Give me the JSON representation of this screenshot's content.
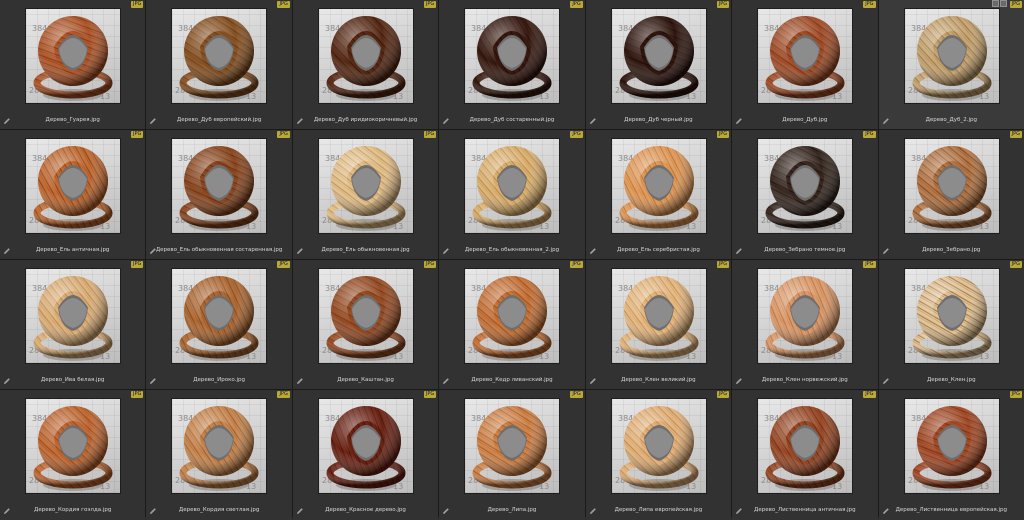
{
  "badge_label": "JPG",
  "materials": [
    {
      "name": "Дерево_Гуарея.jpg",
      "wood": "#b0582a",
      "grain": "#7a3112"
    },
    {
      "name": "Дерево_Дуб европейский.jpg",
      "wood": "#8a5424",
      "grain": "#5c3210"
    },
    {
      "name": "Дерево_Дуб иридиокоричневый.jpg",
      "wood": "#5a2a14",
      "grain": "#2e1208"
    },
    {
      "name": "Дерево_Дуб состаренный.jpg",
      "wood": "#3a1a10",
      "grain": "#1a0a06"
    },
    {
      "name": "Дерево_Дуб черный.jpg",
      "wood": "#32170f",
      "grain": "#150806"
    },
    {
      "name": "Дерево_Дуб.jpg",
      "wood": "#a4502a",
      "grain": "#6e2c12"
    },
    {
      "name": "Дерево_Дуб_2.jpg",
      "wood": "#c7a572",
      "grain": "#8a6a3c",
      "selected": true
    },
    {
      "name": "Дерево_Ель античная.jpg",
      "wood": "#c26a30",
      "grain": "#7e3812"
    },
    {
      "name": "Дерево_Ель обыкновенная состаренная.jpg",
      "wood": "#8e4a22",
      "grain": "#5a2a10"
    },
    {
      "name": "Дерево_Ель обыкновенная.jpg",
      "wood": "#e3c08a",
      "grain": "#b08850"
    },
    {
      "name": "Дерево_Ель обыкновенная_2.jpg",
      "wood": "#dcb272",
      "grain": "#a87c3e"
    },
    {
      "name": "Дерево_Ель серебристая.jpg",
      "wood": "#e09a5a",
      "grain": "#b26a2c"
    },
    {
      "name": "Дерево_Зебрано темное.jpg",
      "wood": "#3a2a22",
      "grain": "#140c08"
    },
    {
      "name": "Дерево_Зебрано.jpg",
      "wood": "#b67644",
      "grain": "#6a3a18"
    },
    {
      "name": "Дерево_Ива белая.jpg",
      "wood": "#ddb07a",
      "grain": "#a8804a"
    },
    {
      "name": "Дерево_Ироко.jpg",
      "wood": "#b06a34",
      "grain": "#784018"
    },
    {
      "name": "Дерево_Каштан.jpg",
      "wood": "#9a4e26",
      "grain": "#66300f"
    },
    {
      "name": "Дерево_Кедр ливанский.jpg",
      "wood": "#c8743a",
      "grain": "#8a4618"
    },
    {
      "name": "Дерево_Клен великий.jpg",
      "wood": "#e6b880",
      "grain": "#b48650"
    },
    {
      "name": "Дерево_Клен норвежский.jpg",
      "wood": "#dc9a6a",
      "grain": "#a86a3c"
    },
    {
      "name": "Дерево_Клен.jpg",
      "wood": "#e2c294",
      "grain": "#8a6030"
    },
    {
      "name": "Дерево_Кордия гоэлда.jpg",
      "wood": "#c26a34",
      "grain": "#884016"
    },
    {
      "name": "Дерево_Кордия светлая.jpg",
      "wood": "#c8864e",
      "grain": "#8e5626"
    },
    {
      "name": "Дерево_Красное дерево.jpg",
      "wood": "#6e2414",
      "grain": "#3e0e06"
    },
    {
      "name": "Дерево_Липа.jpg",
      "wood": "#d0844a",
      "grain": "#94501e"
    },
    {
      "name": "Дерево_Липа европейская.jpg",
      "wood": "#e4b27a",
      "grain": "#b0804a"
    },
    {
      "name": "Дерево_Лиственница античная.jpg",
      "wood": "#9c4a26",
      "grain": "#5e2610"
    },
    {
      "name": "Дерево_Лиственница европейская.jpg",
      "wood": "#a64c28",
      "grain": "#6a2a12"
    }
  ]
}
